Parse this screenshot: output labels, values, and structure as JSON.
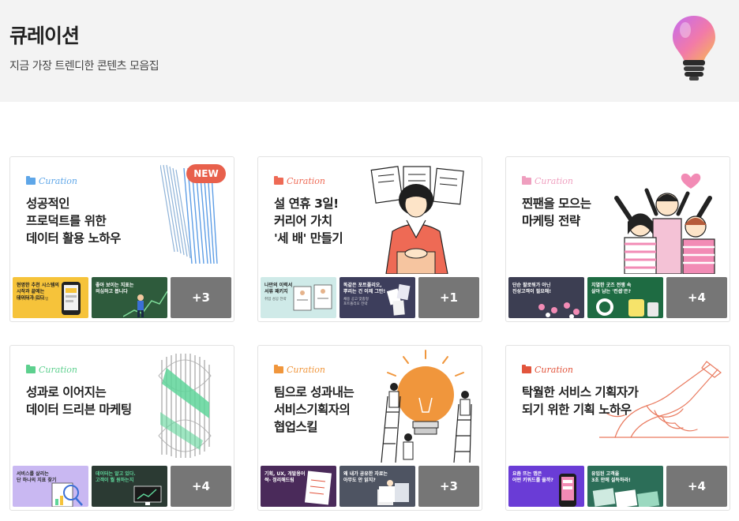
{
  "header": {
    "title": "큐레이션",
    "subtitle": "지금 가장 트렌디한 콘텐츠 모음집"
  },
  "cards": [
    {
      "tag": "Curation",
      "tag_color": "#5ea6e8",
      "title": "성공적인\n프로덕트를 위한\n데이터 활용 노하우",
      "badge": "NEW",
      "more": "+3",
      "thumbs": [
        {
          "text": "현명한 추천 시스템의\n시작과 끝에는\n데이터가 있다",
          "sub": "데이터와 추천 시스템",
          "bg": "#f6c33a",
          "fg": "#222"
        },
        {
          "text": "좋아 보이는 지표는\n의심하고 봅니다",
          "sub": "데이터를 의심하는 방법",
          "bg": "#2e5b3c",
          "fg": "#ffffff"
        }
      ]
    },
    {
      "tag": "Curation",
      "tag_color": "#ee6a55",
      "title": "설 연휴 3일!\n커리어 가치\n'세 배' 만들기",
      "more": "+1",
      "thumbs": [
        {
          "text": "나만의 이력서\n서류 패키지",
          "sub": "취업 성공 전략",
          "bg": "#cfeae8",
          "fg": "#222"
        },
        {
          "text": "똑같은 포트폴리오,\n뿌리는 건 이제 그만!",
          "sub": "채용 공고 맞춤형\n포트폴리오 전략",
          "bg": "#3d3e5c",
          "fg": "#ffffff"
        }
      ]
    },
    {
      "tag": "Curation",
      "tag_color": "#ef9fbf",
      "title": "찐팬을 모으는\n마케팅 전략",
      "more": "+4",
      "thumbs": [
        {
          "text": "단순 팔로워가 아닌\n진성고객이 필요해!",
          "sub": "진성고객 마케팅",
          "bg": "#3c3e52",
          "fg": "#ffffff"
        },
        {
          "text": "치열한 굿즈 전쟁 속\n살아 남는 '컨셉'은?",
          "sub": "굿즈 마케팅 사례",
          "bg": "#1e6b42",
          "fg": "#ffffff"
        }
      ]
    },
    {
      "tag": "Curation",
      "tag_color": "#5dd08e",
      "title": "성과로 이어지는\n데이터 드리븐 마케팅",
      "more": "+4",
      "thumbs": [
        {
          "text": "서비스를 살리는\n단 하나의 지표 찾기",
          "sub": "북극성 지표",
          "bg": "#c9b8f2",
          "fg": "#2a2a2a"
        },
        {
          "text": "데이터는 알고 있다.\n고객이 뭘 원하는지",
          "sub": "고객 데이터 분석",
          "bg": "#2b3a33",
          "fg": "#ffffff"
        }
      ]
    },
    {
      "tag": "Curation",
      "tag_color": "#f0963c",
      "title": "팀으로 성과내는\n서비스기획자의\n협업스킬",
      "more": "+3",
      "thumbs": [
        {
          "text": "기획, UX, 개발용어\n싹- 정리해드림",
          "sub": "용어 정리",
          "bg": "#4a2a5a",
          "fg": "#ffffff"
        },
        {
          "text": "왜 내가 공유한 자료는\n아무도 안 읽지?",
          "sub": "협업 문서 작성법",
          "bg": "#4e5462",
          "fg": "#ffffff"
        }
      ]
    },
    {
      "tag": "Curation",
      "tag_color": "#e2553d",
      "title": "탁월한 서비스 기획자가\n되기 위한 기획 노하우",
      "more": "+4",
      "thumbs": [
        {
          "text": "요즘 뜨는 앱은\n어떤 키워드를 쓸까?",
          "sub": "서비스 트렌드",
          "bg": "#6a3cd6",
          "fg": "#ffffff"
        },
        {
          "text": "유입된 고객을\n3초 안에 설득하라!",
          "sub": "랜딩 페이지 기획",
          "bg": "#2c6e58",
          "fg": "#ffffff"
        }
      ]
    }
  ]
}
